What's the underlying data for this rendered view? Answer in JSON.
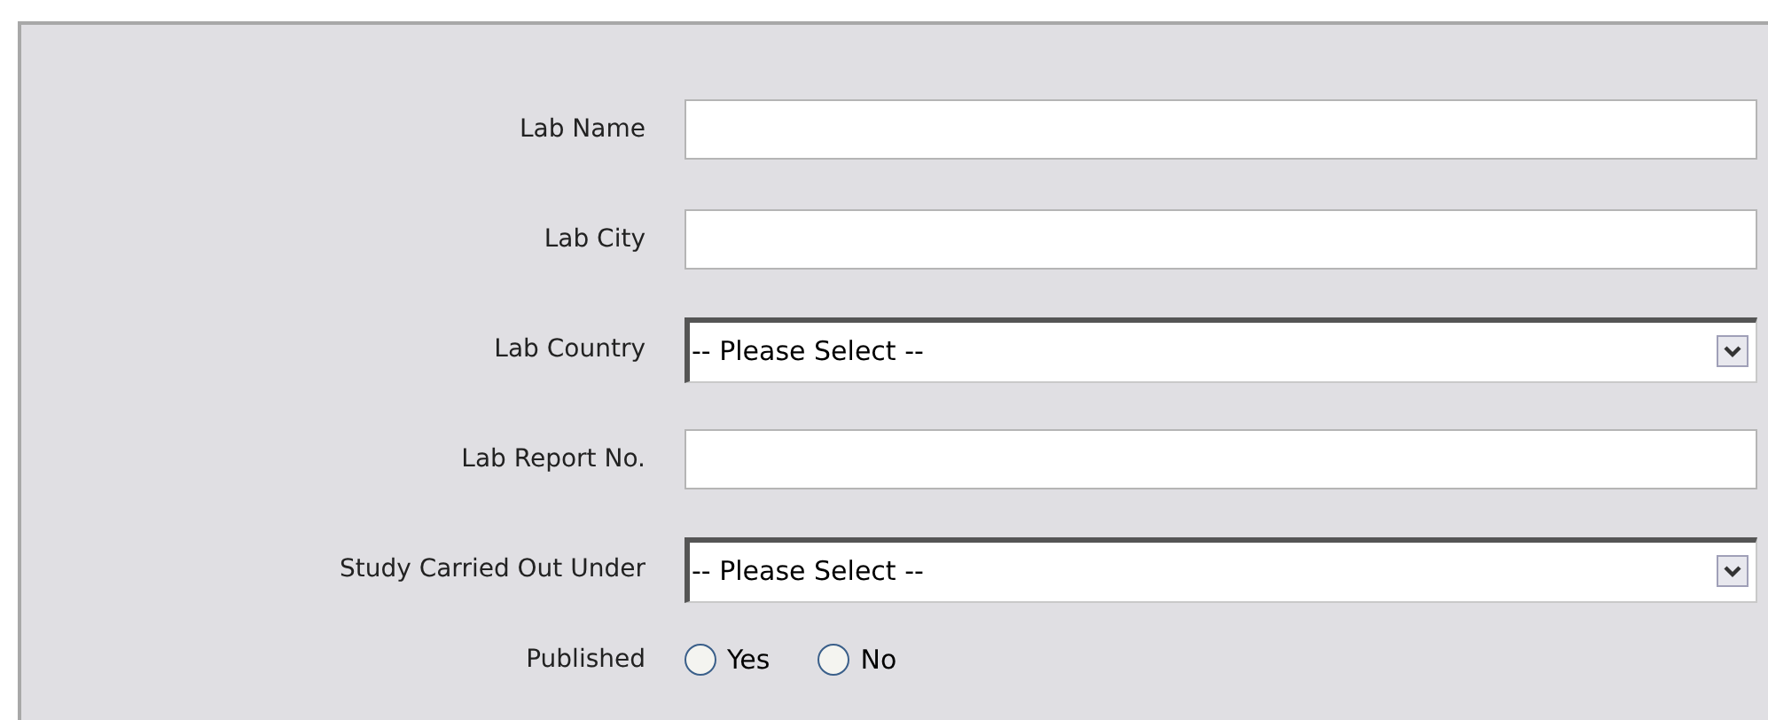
{
  "fields": [
    {
      "kind": "text",
      "label": "Lab Name"
    },
    {
      "kind": "text",
      "label": "Lab City"
    },
    {
      "kind": "select",
      "label": "Lab Country",
      "value": "-- Please Select --"
    },
    {
      "kind": "text",
      "label": "Lab Report No."
    },
    {
      "kind": "select",
      "label": "Study Carried Out Under",
      "value": "-- Please Select --"
    },
    {
      "kind": "radio",
      "label": "Published",
      "options": [
        {
          "label": "Yes",
          "selected": false
        },
        {
          "label": "No",
          "selected": false
        }
      ]
    }
  ]
}
